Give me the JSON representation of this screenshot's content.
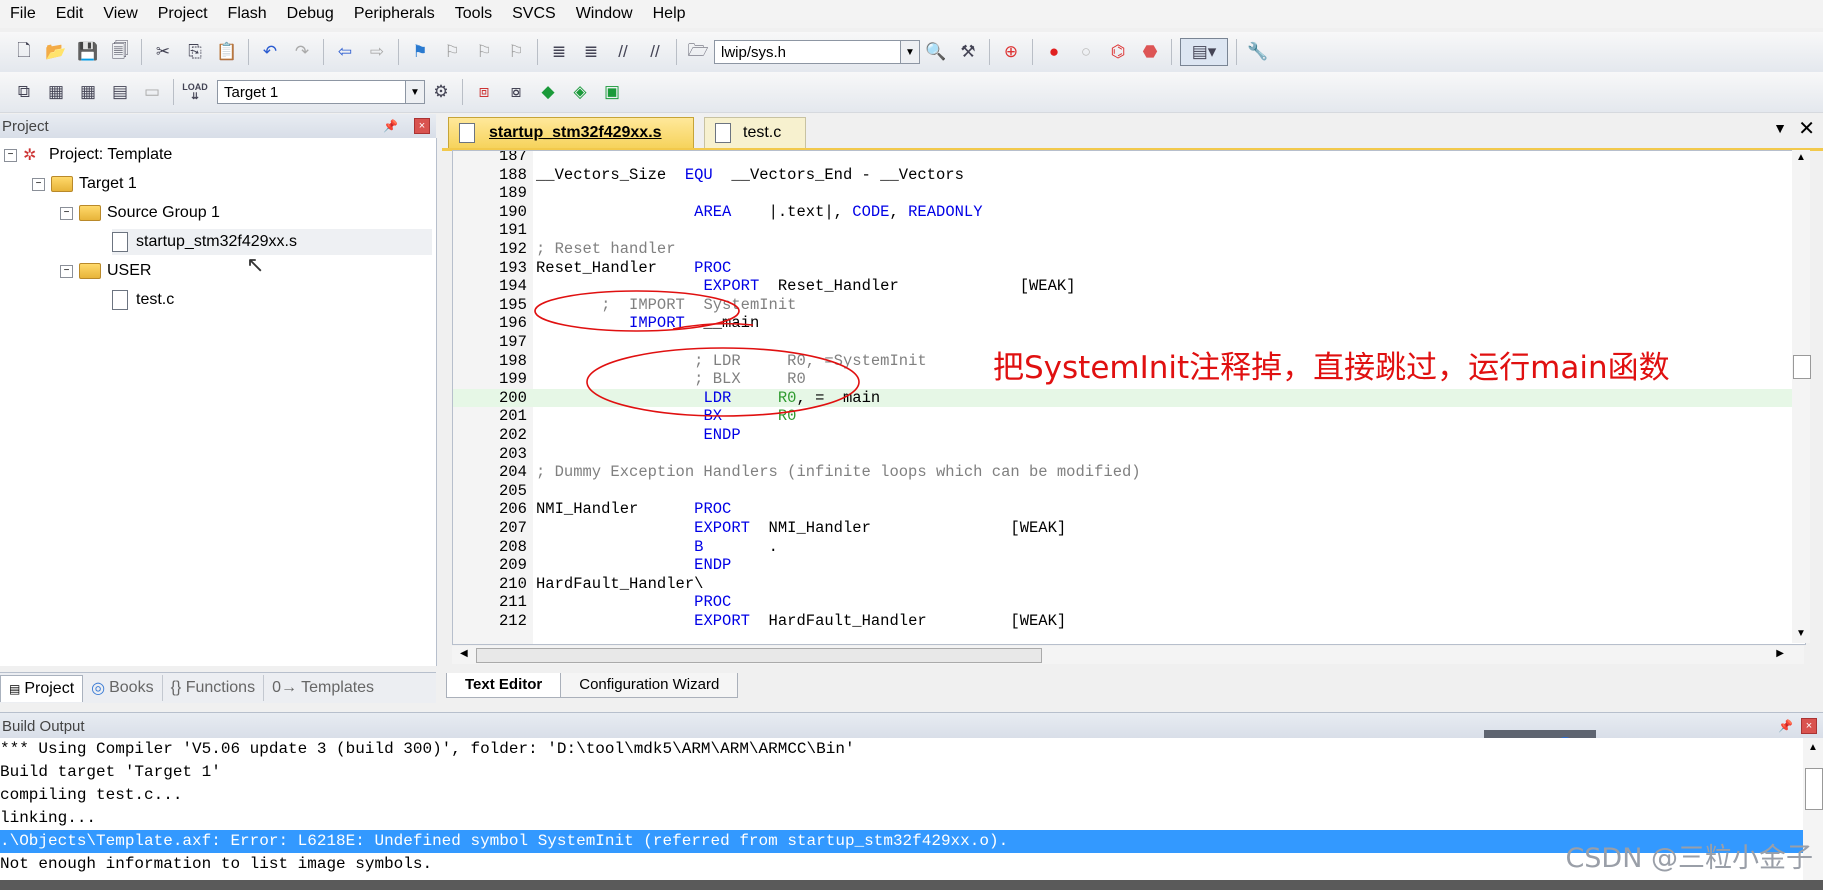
{
  "menubar": [
    "File",
    "Edit",
    "View",
    "Project",
    "Flash",
    "Debug",
    "Peripherals",
    "Tools",
    "SVCS",
    "Window",
    "Help"
  ],
  "toolbar1": {
    "file_combo": "lwip/sys.h"
  },
  "toolbar2": {
    "load_label": "LOAD",
    "target_combo": "Target 1"
  },
  "project_panel": {
    "title": "Project",
    "tree": {
      "project": "Project: Template",
      "target": "Target 1",
      "group1": "Source Group 1",
      "group1_file": "startup_stm32f429xx.s",
      "group2": "USER",
      "group2_file": "test.c"
    },
    "tabs": [
      "Project",
      "Books",
      "{} Functions",
      "0→ Templates"
    ]
  },
  "editor": {
    "tabs": [
      "startup_stm32f429xx.s",
      "test.c"
    ],
    "bottom_tabs": [
      "Text Editor",
      "Configuration Wizard"
    ],
    "lines": [
      {
        "n": "187",
        "t": ""
      },
      {
        "n": "188",
        "t": "__Vectors_Size  EQU  __Vectors_End - __Vectors"
      },
      {
        "n": "189",
        "t": ""
      },
      {
        "n": "190",
        "t": "                 AREA    |.text|, CODE, READONLY"
      },
      {
        "n": "191",
        "t": ""
      },
      {
        "n": "192",
        "t": "; Reset handler"
      },
      {
        "n": "193",
        "t": "Reset_Handler    PROC"
      },
      {
        "n": "194",
        "t": "                  EXPORT  Reset_Handler             [WEAK]"
      },
      {
        "n": "195",
        "t": "       ;  IMPORT  SystemInit"
      },
      {
        "n": "196",
        "t": "          IMPORT  __main"
      },
      {
        "n": "197",
        "t": ""
      },
      {
        "n": "198",
        "t": "                 ; LDR     R0, =SystemInit"
      },
      {
        "n": "199",
        "t": "                 ; BLX     R0"
      },
      {
        "n": "200",
        "t": "                  LDR     R0, =  main"
      },
      {
        "n": "201",
        "t": "                  BX      R0"
      },
      {
        "n": "202",
        "t": "                  ENDP"
      },
      {
        "n": "203",
        "t": ""
      },
      {
        "n": "204",
        "t": "; Dummy Exception Handlers (infinite loops which can be modified)"
      },
      {
        "n": "205",
        "t": ""
      },
      {
        "n": "206",
        "t": "NMI_Handler      PROC"
      },
      {
        "n": "207",
        "t": "                 EXPORT  NMI_Handler               [WEAK]"
      },
      {
        "n": "208",
        "t": "                 B       ."
      },
      {
        "n": "209",
        "t": "                 ENDP"
      },
      {
        "n": "210",
        "t": "HardFault_Handler\\"
      },
      {
        "n": "211",
        "t": "                 PROC"
      },
      {
        "n": "212",
        "t": "                 EXPORT  HardFault_Handler         [WEAK]"
      }
    ]
  },
  "annotation": "把SystemInit注释掉，直接跳过，运行main函数",
  "build_output": {
    "title": "Build Output",
    "lines": [
      "*** Using Compiler 'V5.06 update 3 (build 300)', folder: 'D:\\tool\\mdk5\\ARM\\ARM\\ARMCC\\Bin'",
      "Build target 'Target 1'",
      "compiling test.c...",
      "linking...",
      ".\\Objects\\Template.axf: Error: L6218E: Undefined symbol SystemInit (referred from startup_stm32f429xx.o).",
      "Not enough information to list image symbols."
    ]
  },
  "watermark": "CSDN @三粒小金子",
  "colors": {
    "keyword": "#0000e6",
    "comment": "#808080",
    "register": "#2e9a2e",
    "error_bg": "#3399ff",
    "annotation": "#e01010"
  }
}
